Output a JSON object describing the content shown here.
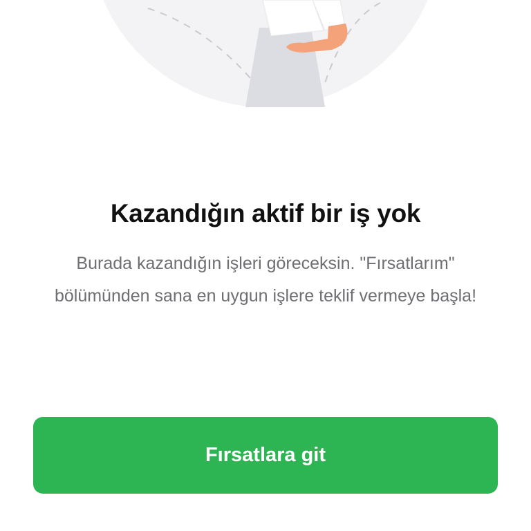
{
  "empty_state": {
    "title": "Kazandığın aktif bir iş yok",
    "description": "Burada kazandığın işleri göreceksin. \"Fırsatlarım\" bölümünden sana en uygun işlere teklif vermeye başla!",
    "illustration": "person-illustration"
  },
  "cta": {
    "label": "Fırsatlara git"
  },
  "colors": {
    "accent": "#2db553",
    "title": "#111111",
    "description": "#6e6e73",
    "illustration_bg": "#f3f3f5"
  }
}
